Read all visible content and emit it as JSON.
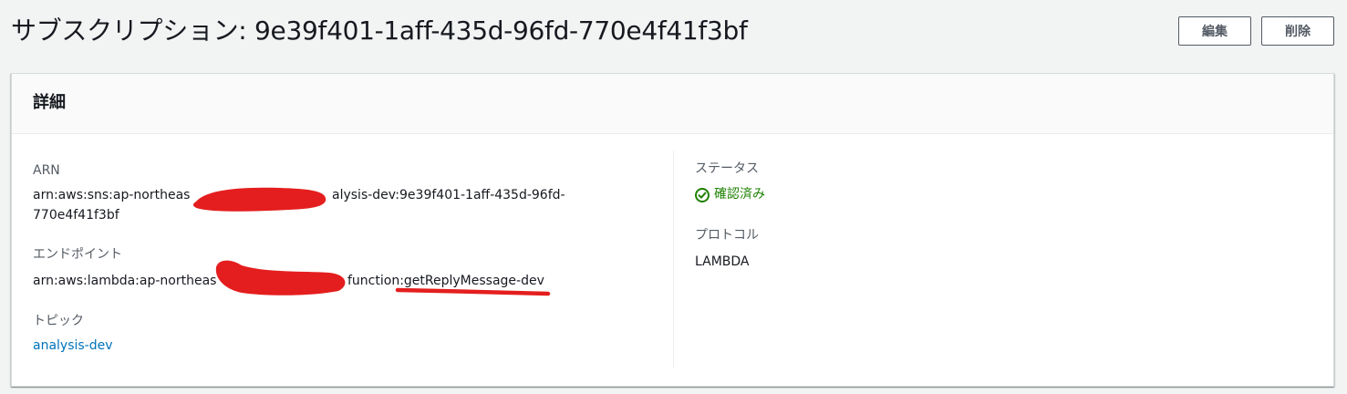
{
  "header": {
    "title": "サブスクリプション: 9e39f401-1aff-435d-96fd-770e4f41f3bf",
    "edit_label": "編集",
    "delete_label": "削除"
  },
  "details": {
    "title": "詳細",
    "arn": {
      "label": "ARN",
      "value": "arn:aws:sns:ap-northeas",
      "value_suffix_line1": "alysis-dev:9e39f401-1aff-435d-96fd-",
      "value_line2": "770e4f41f3bf"
    },
    "endpoint": {
      "label": "エンドポイント",
      "value_prefix": "arn:aws:lambda:ap-northeas",
      "value_suffix": "function:getReplyMessage-dev"
    },
    "topic": {
      "label": "トピック",
      "value": "analysis-dev"
    },
    "status": {
      "label": "ステータス",
      "value": "確認済み",
      "color": "#1d8102",
      "icon": "status-check-icon"
    },
    "protocol": {
      "label": "プロトコル",
      "value": "LAMBDA"
    }
  },
  "colors": {
    "link": "#0073bb",
    "redaction": "#e41e1e",
    "background": "#f2f3f3"
  }
}
